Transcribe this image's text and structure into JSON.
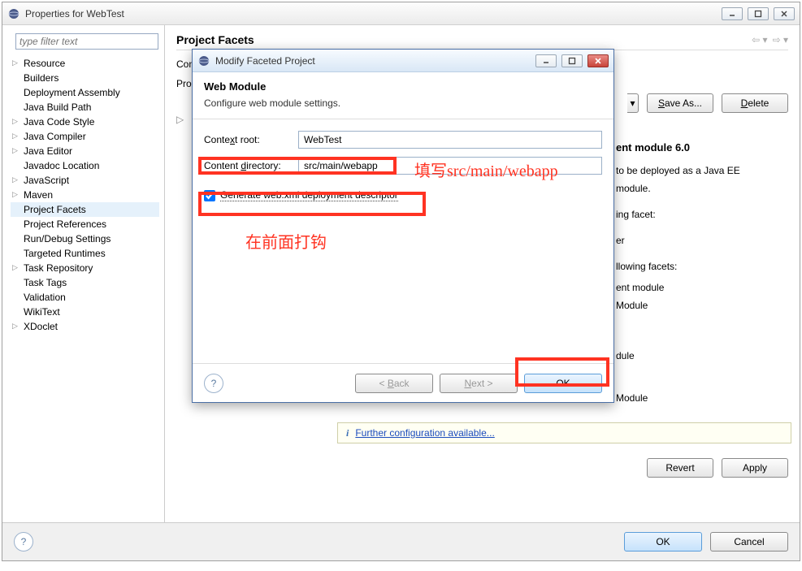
{
  "props_window": {
    "title": "Properties for WebTest",
    "filter_placeholder": "type filter text",
    "tree": [
      {
        "label": "Resource",
        "exp": true
      },
      {
        "label": "Builders"
      },
      {
        "label": "Deployment Assembly"
      },
      {
        "label": "Java Build Path"
      },
      {
        "label": "Java Code Style",
        "exp": true
      },
      {
        "label": "Java Compiler",
        "exp": true
      },
      {
        "label": "Java Editor",
        "exp": true
      },
      {
        "label": "Javadoc Location"
      },
      {
        "label": "JavaScript",
        "exp": true
      },
      {
        "label": "Maven",
        "exp": true
      },
      {
        "label": "Project Facets",
        "sel": true
      },
      {
        "label": "Project References"
      },
      {
        "label": "Run/Debug Settings"
      },
      {
        "label": "Targeted Runtimes"
      },
      {
        "label": "Task Repository",
        "exp": true
      },
      {
        "label": "Task Tags"
      },
      {
        "label": "Validation"
      },
      {
        "label": "WikiText"
      },
      {
        "label": "XDoclet",
        "exp": true
      }
    ],
    "main": {
      "heading": "Project Facets",
      "conf_label_visible": "Conf",
      "proj_tab_visible": "Pro",
      "save_as": "Save As...",
      "delete": "Delete",
      "bg_heading_tail": "ent module 6.0",
      "bg_line1": "to be deployed as a Java EE",
      "bg_line2": "module.",
      "bg_line3": "ing facet:",
      "bg_line4": "er",
      "bg_line5": "llowing facets:",
      "bg_line6": "ent module",
      "bg_line7": "Module",
      "bg_line8": "dule",
      "bg_line9": "Module",
      "further_config": "Further configuration available...",
      "revert": "Revert",
      "apply": "Apply",
      "ok": "OK",
      "cancel": "Cancel"
    }
  },
  "modal": {
    "title": "Modify Faceted Project",
    "head_title": "Web Module",
    "head_desc": "Configure web module settings.",
    "context_root_label": "Context root:",
    "context_root_value": "WebTest",
    "content_dir_label": "Content directory:",
    "content_dir_value": "src/main/webapp",
    "gen_webxml_label": "Generate web.xml deployment descriptor",
    "gen_webxml_checked": true,
    "back": "< Back",
    "next": "Next >",
    "ok": "OK"
  },
  "annotations": {
    "text1": "填写src/main/webapp",
    "text2": "在前面打钩"
  }
}
